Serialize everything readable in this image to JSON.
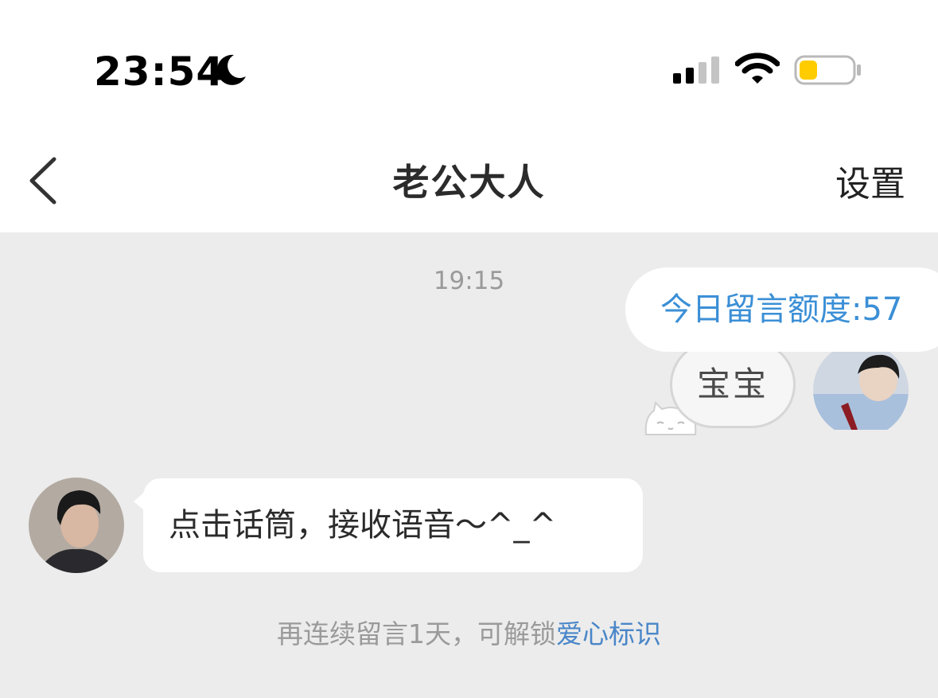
{
  "status_bar": {
    "time": "23:54",
    "icons": [
      "moon-icon",
      "signal-icon",
      "wifi-icon",
      "battery-icon"
    ],
    "battery_color": "#FFCC00"
  },
  "nav": {
    "back_icon": "chevron-left-icon",
    "title": "老公大人",
    "settings_label": "设置"
  },
  "chat": {
    "timestamp": "19:15",
    "quota_banner": "今日留言额度:57",
    "messages": [
      {
        "from": "me",
        "text": "宝宝"
      },
      {
        "from": "other",
        "text": "点击话筒，接收语音～^_^"
      }
    ],
    "unlock_hint_prefix": "再连续留言1天，可解锁",
    "unlock_hint_link": "爱心标识"
  },
  "colors": {
    "chat_background": "#ECECEC",
    "link_blue": "#3B8FD6",
    "hint_gray": "#9A9A9A"
  }
}
